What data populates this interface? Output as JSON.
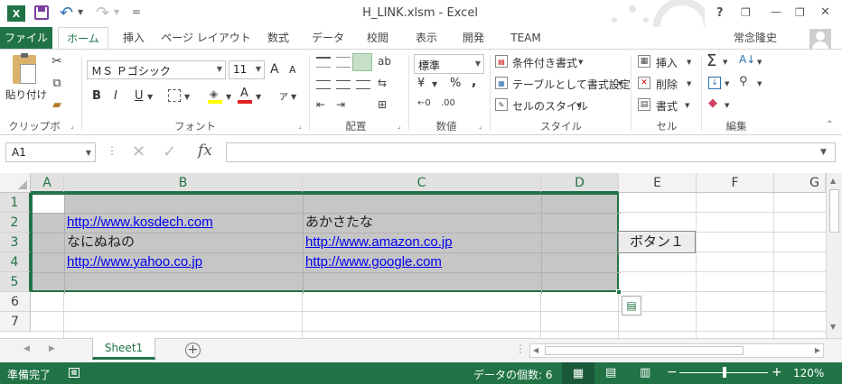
{
  "window": {
    "title": "H_LINK.xlsm - Excel",
    "help": "?",
    "minimize": "—",
    "restore": "❐",
    "close": "✕",
    "qat_more": "="
  },
  "tabs": {
    "file": "ファイル",
    "items": [
      "ホーム",
      "挿入",
      "ページ レイアウト",
      "数式",
      "データ",
      "校閲",
      "表示",
      "開発",
      "TEAM"
    ],
    "active": "ホーム",
    "user": "常念隆史"
  },
  "ribbon": {
    "clipboard": {
      "paste": "貼り付け",
      "label": "クリップボード"
    },
    "font": {
      "name": "ＭＳ Ｐゴシック",
      "size": "11",
      "grow": "A",
      "shrink": "A",
      "bold": "B",
      "italic": "I",
      "underline": "U",
      "label": "フォント"
    },
    "alignment": {
      "label": "配置"
    },
    "number": {
      "format": "標準",
      "currency": "¥",
      "percent": "%",
      "comma": ",",
      "label": "数値"
    },
    "styles": {
      "conditional": "条件付き書式",
      "table": "テーブルとして書式設定",
      "cell": "セルのスタイル",
      "label": "スタイル"
    },
    "cells": {
      "insert": "挿入",
      "delete": "削除",
      "format": "書式",
      "label": "セル"
    },
    "editing": {
      "sum": "Σ",
      "label": "編集"
    }
  },
  "formula_bar": {
    "name_box": "A1",
    "fx": "fx",
    "content": ""
  },
  "sheet": {
    "columns": [
      "A",
      "B",
      "C",
      "D",
      "E",
      "F",
      "G"
    ],
    "rows": [
      "1",
      "2",
      "3",
      "4",
      "5",
      "6",
      "7"
    ],
    "cells": {
      "B2": "http://www.kosdech.com",
      "C2": "あかさたな",
      "B3": "なにぬねの",
      "C3": "http://www.amazon.co.jp",
      "B4": "http://www.yahoo.co.jp",
      "C4": "http://www.google.com"
    },
    "button": "ボタン１"
  },
  "sheet_tabs": {
    "active": "Sheet1"
  },
  "status": {
    "ready": "準備完了",
    "count": "データの個数: 6",
    "zoom": "120%"
  },
  "colors": {
    "accent": "#217346",
    "selection": "#c6c6c6",
    "link": "#0000ee"
  }
}
